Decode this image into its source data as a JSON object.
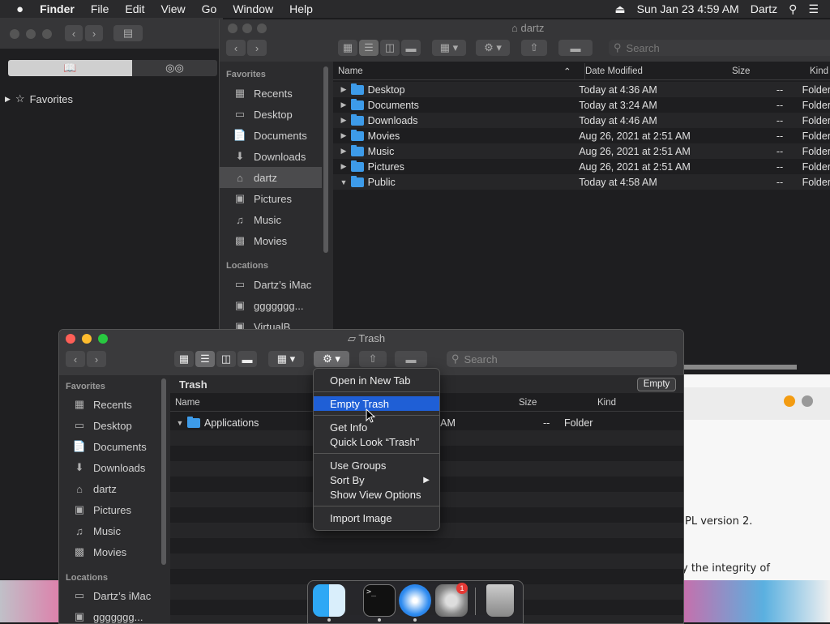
{
  "menubar": {
    "apple": "",
    "app": "Finder",
    "items": [
      "File",
      "Edit",
      "View",
      "Go",
      "Window",
      "Help"
    ],
    "datetime": "Sun Jan 23  4:59 AM",
    "user": "Dartz"
  },
  "left_window": {
    "sidebar_favorites": "Favorites"
  },
  "dartz_window": {
    "title": "dartz",
    "search_placeholder": "Search",
    "sidebar": {
      "favorites_header": "Favorites",
      "favorites": [
        {
          "label": "Recents",
          "icon": "recents-icon"
        },
        {
          "label": "Desktop",
          "icon": "desktop-icon"
        },
        {
          "label": "Documents",
          "icon": "documents-icon"
        },
        {
          "label": "Downloads",
          "icon": "downloads-icon"
        },
        {
          "label": "dartz",
          "icon": "home-icon"
        },
        {
          "label": "Pictures",
          "icon": "pictures-icon"
        },
        {
          "label": "Music",
          "icon": "music-icon"
        },
        {
          "label": "Movies",
          "icon": "movies-icon"
        }
      ],
      "locations_header": "Locations",
      "locations": [
        {
          "label": "Dartz’s iMac",
          "icon": "imac-icon"
        },
        {
          "label": "ggggggg...",
          "icon": "disk-icon"
        },
        {
          "label": "VirtualB...",
          "icon": "disk-icon"
        }
      ]
    },
    "columns": {
      "name": "Name",
      "date": "Date Modified",
      "size": "Size",
      "kind": "Kind"
    },
    "rows": [
      {
        "name": "Desktop",
        "date": "Today at 4:36 AM",
        "size": "--",
        "kind": "Folder"
      },
      {
        "name": "Documents",
        "date": "Today at 3:24 AM",
        "size": "--",
        "kind": "Folder"
      },
      {
        "name": "Downloads",
        "date": "Today at 4:46 AM",
        "size": "--",
        "kind": "Folder"
      },
      {
        "name": "Movies",
        "date": "Aug 26, 2021 at 2:51 AM",
        "size": "--",
        "kind": "Folder"
      },
      {
        "name": "Music",
        "date": "Aug 26, 2021 at 2:51 AM",
        "size": "--",
        "kind": "Folder"
      },
      {
        "name": "Pictures",
        "date": "Aug 26, 2021 at 2:51 AM",
        "size": "--",
        "kind": "Folder"
      },
      {
        "name": "Public",
        "date": "Today at 4:58 AM",
        "size": "--",
        "kind": "Folder"
      }
    ]
  },
  "trash_window": {
    "title": "Trash",
    "search_placeholder": "Search",
    "path_label": "Trash",
    "empty_button": "Empty",
    "sidebar": {
      "favorites_header": "Favorites",
      "favorites": [
        {
          "label": "Recents"
        },
        {
          "label": "Desktop"
        },
        {
          "label": "Documents"
        },
        {
          "label": "Downloads"
        },
        {
          "label": "dartz"
        },
        {
          "label": "Pictures"
        },
        {
          "label": "Music"
        },
        {
          "label": "Movies"
        }
      ],
      "locations_header": "Locations",
      "locations": [
        {
          "label": "Dartz’s iMac"
        },
        {
          "label": "ggggggg..."
        }
      ]
    },
    "columns": {
      "name": "Name",
      "size": "Size",
      "kind": "Kind"
    },
    "rows": [
      {
        "name": "Applications",
        "date": "4:01 AM",
        "size": "--",
        "kind": "Folder"
      }
    ]
  },
  "context_menu": {
    "items": [
      {
        "label": "Open in New Tab"
      },
      {
        "label": "Empty Trash"
      },
      {
        "label": "Get Info"
      },
      {
        "label": "Quick Look “Trash”"
      },
      {
        "label": "Use Groups"
      },
      {
        "label": "Sort By"
      },
      {
        "label": "Show View Options"
      },
      {
        "label": "Import Image"
      }
    ]
  },
  "background_text": {
    "line1": "PL version 2.",
    "line2": "y the integrity of"
  },
  "dock": {
    "apps": [
      "finder-icon",
      "terminal-icon",
      "safari-icon",
      "system-preferences-icon",
      "trash-icon"
    ],
    "badge": "1"
  },
  "colors": {
    "accent": "#1f5fd6",
    "folder": "#3d9be9",
    "close": "#fe5f57",
    "minimize": "#febc2e",
    "zoom": "#28c840"
  }
}
